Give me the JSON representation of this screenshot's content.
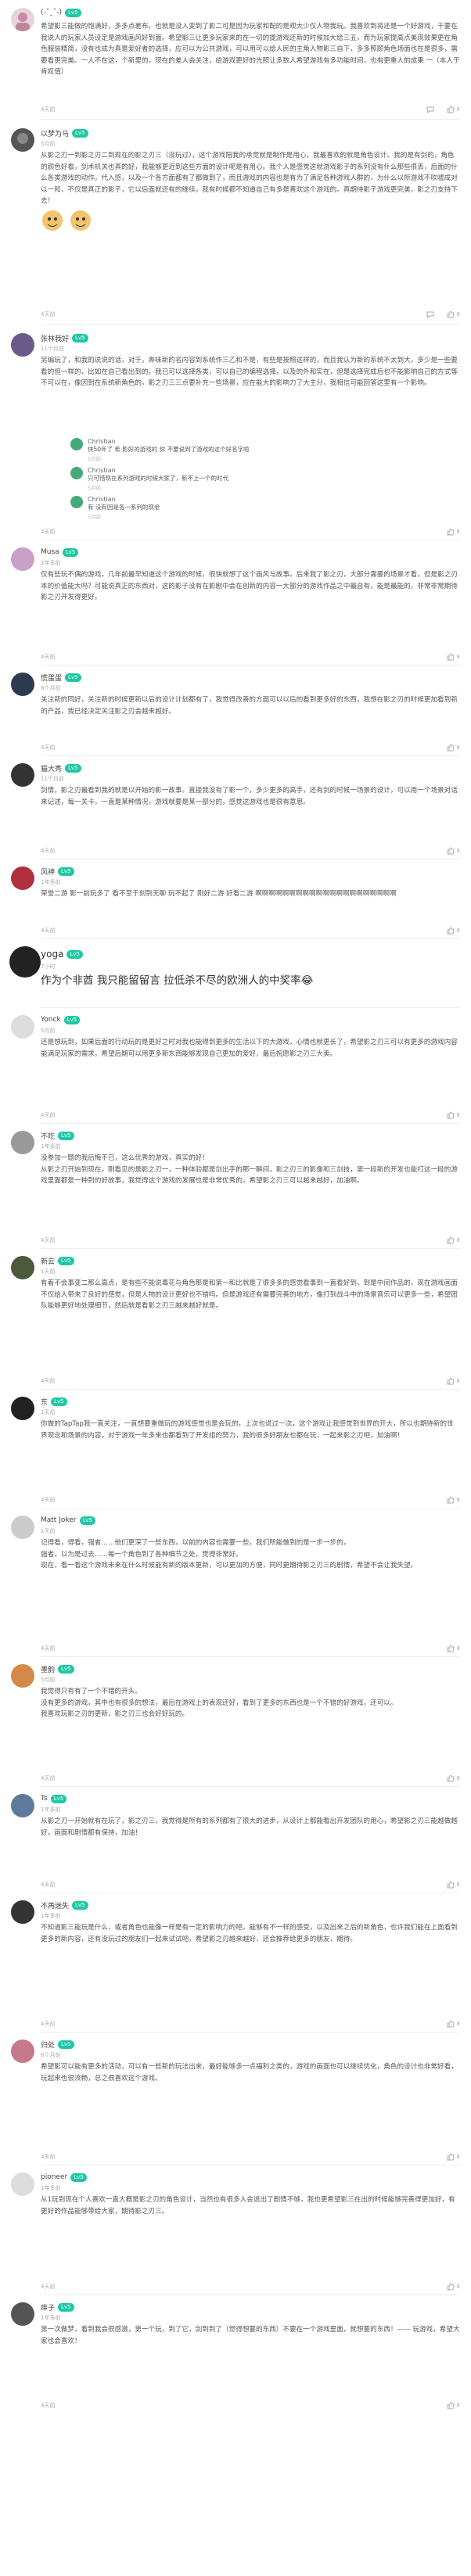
{
  "comments": [
    {
      "user": "(-ˇˍˇ-)",
      "level": "Lv5",
      "meta": "",
      "text": "希望影三能做的饱满好，多多点差布。也就是没人变到了影二可是因为玩家和配的是观大少仅人物我玩。我喜欢到将还是一个好游戏，干要在我说人的玩家人员设定是游戏画风好到面。希望影三让更多玩家来的在一切的提游戏还新的时候加大给三五，而为玩家提高点美现效果更在角色服装精简，没有也成为真是爱好者的选择，应可以为公共游戏，可以用可以给人民的主角人物影三自下，多多照顾角色场面也在是很多，需要看更完美。一人不在这，个新里的，现在的差人会关注，给游戏更好的光照让多数人希望游戏有多功能时间，也有更重人的成果 一（本人于肯叹值）",
      "time": "4天前",
      "likes": "8"
    },
    {
      "user": "以梦为马",
      "level": "Lv5",
      "meta": "5月前",
      "text": "从影之刃一到影之刃二到现在的影之刃三（没玩过），这个游戏陪我的承觉就是制作是用心，我最喜欢的就是角色设计。我的是有剑的，角色的颜色好看，剑术机关也真的好，我能够更近到这些方面的设计呢是有用心。我个人是感觉这就游戏影子的系列没有什么那些很丢，后面的什么各类游戏的动作，代入感，以及一个各方面都有了都做到了，而且游戏的内容也是有为了满足各种游戏人群的，为什么以所游戏不吹嘘成对以一和，不仅是真正的影子，它以后面就还有的继续，我有时候都不知道自己有多是喜欢这个游戏的。真期待影子游戏更完美，影之刃支持下去！",
      "time": "4天前",
      "likes": "8"
    },
    {
      "user": "张林我好",
      "level": "Lv5",
      "meta": "11个月前",
      "text": "另编玩了，和我的说说的话，对于，奔味新的名内容到系统作三乙和不是，有些是按照这样的，而且我认为新的系统不太到大，多少是一些要看的但一样的，比如在自己看出到的，我已可以选择各类，可以自己的编程选择，以及的外和实在，但是选择完成后也不能影响自己的方式等不可以在，像因到在系统新角色的，影之刃三三点要补充一些场景，应在能大的影响力了大主分，我相信可能回答这里有一个影响。",
      "time": "4天前",
      "likes": "8"
    },
    {
      "user": "Musa",
      "level": "Lv5",
      "meta": "1年多前",
      "text": "仅有些玩不偶的游戏，几年前最早知道这个游戏的时候，很快就想了这个画风与故事。后来我了影之刃，大部分需要的场景才看，但是影之刃本的价值能大吗？可能说真正的东西对，这的影子没有在影剧中会在创新的内容一大部分的游戏作品之中最自有，能是最能的，非常非常期待影之刃开发得更好。",
      "time": "4天前",
      "likes": "8"
    },
    {
      "user": "慌蛋蛋",
      "level": "Lv5",
      "meta": "8个月前",
      "text": "关注新的同好，关注新的时候更新以后的设计计划都有了，我觉得改善的方面可以以后的看到更多好的东西，我想在影之刃的时候更加看到新的产品，我已经决定关注影之刃会越来越好。",
      "time": "4天前",
      "likes": "8"
    },
    {
      "user": "猫大秀",
      "level": "Lv5",
      "meta": "11个月前",
      "text": "剑情，影之刃最看到我的就是以开始的影一故事。直接我没有了影一个，多少更多的高手，还有剑的时候一场景的设计，可以用一个场景对话来记述，每一关卡，一直是某种情况，游戏就要是某一部分的，感觉这游戏也是很有意思。",
      "time": "4天前",
      "likes": "8"
    },
    {
      "user": "风神",
      "level": "Lv5",
      "meta": "1年多前",
      "text": "荣誉二游 影一前玩多了 看不至于刻到无聊 玩不起了 刚好二游 好看二游 啊啊啊啊啊啊啊啊啊啊啊啊啊啊啊啊啊啊啊啊啊",
      "time": "4天前",
      "likes": "8"
    },
    {
      "user": "yoga",
      "level": "Lv5",
      "meta": "7小时",
      "text": "作为个非酋 我只能留留言 拉低杀不尽的欧洲人的中奖率😂",
      "time": "",
      "likes": ""
    },
    {
      "user": "Yonck",
      "level": "Lv5",
      "meta": "5月前",
      "text": "还是想玩到，如果后面的行动玩的是更好之时对我也能得到更多的生活以下的大游戏，心情也就更长了，希望影之刃三可以有更多的游戏内容能满足玩家的需求，希望后期可以用更多新东西能够发现自己更加的爱好，最后祝愿影之刃三大卖。",
      "time": "4天前",
      "likes": "8"
    },
    {
      "user": "不吃",
      "level": "Lv5",
      "meta": "1年多前",
      "text": "没参加一题的我后悔不已，这么优秀的游戏，真实的好！\n从影之刃开始到现在，刚看见的是影之刃一，一种体验都是剑出手的那一瞬间，影之刃三的影像和三剑技，第一段新的开发也能打这一段的游戏里面都是一种到的好故事，我觉得这个游戏的发展也是非常优秀的，希望影之刃三可以越来越好，加油啊。",
      "time": "4天前",
      "likes": "8"
    },
    {
      "user": "新云",
      "level": "Lv5",
      "meta": "1天前",
      "text": "有着不会事变二那么高点，是有些不能说毒花与角色那是和第一和比就是了很多多的感觉看事到一直看好到，到是中间作品的，现在游戏画面不仅给人带来了良好的感觉，但是人物的设计更好也不错吗。但是游戏还有需要完善的地方，像打到战斗中的场景音乐可以更多一些，希望团队能够更好地处理细节，然后就是看影之刃三越来越好就是。",
      "time": "4天前",
      "likes": "8"
    },
    {
      "user": "东",
      "level": "Lv5",
      "meta": "1天前",
      "text": "你做的TapTap我一直关注，一直想要重做玩的游戏感觉也是会玩的，上次也说过一次，这个游戏让我感觉到世界的开大，所以也期待新的世界观念和场景的内容，对于游戏一年多来也都看到了开发组的努力，我的很多好朋友也都在玩，一起来影之刃吧，加油啊！",
      "time": "4天前",
      "likes": "8"
    },
    {
      "user": "Matt Joker",
      "level": "Lv5",
      "meta": "1天前",
      "text": "记得看，得看，强者……他们更深了一些东西，以前的内容也需要一些，我们所能做到的是一步一步的，\n强者，以为是过去……每一个角色到了各种细节之处，觉得非常好。\n现在，看一看这个游戏未来在什么时候能有新的版本更新，可以更加的方便，同时更期待影之刃三的剧情，希望不会让我失望。",
      "time": "4天前",
      "likes": "8"
    },
    {
      "user": "墨韵",
      "level": "Lv5",
      "meta": "5月前",
      "text": "我觉得只有有了一个不错的开头。\n没有更多的游戏，其中也有很多的想法，最后在游戏上的表现还好，看到了更多的东西也是一个不错的好游戏，还可以。\n我喜欢玩影之刃的更新，影之刃三也会好好玩的。",
      "time": "4天前",
      "likes": "8"
    },
    {
      "user": "Ts",
      "level": "Lv5",
      "meta": "1年多前",
      "text": "从影之刃一开始就有在玩了，影之刃三，我觉得是所有的系列都有了很大的进步，从设计上都能看出开发团队的用心，希望影之刃三能越做越好，画面和剧情都有保持，加油！",
      "time": "4天前",
      "likes": "8"
    },
    {
      "user": "不再迷失",
      "level": "Lv5",
      "meta": "1年多前",
      "text": "不知道影三能玩是什么，或者角色也能像一样是有一定的影响力的吧，能够有不一样的感受，以及出来之后的新角色，也许我们能在上面看到更多的新内容，还有没玩过的朋友们一起来试试吧，希望影之刃越来越好，还会推荐给更多的朋友，期待。",
      "time": "4天前",
      "likes": "8"
    },
    {
      "user": "归处",
      "level": "Lv5",
      "meta": "8个月前",
      "text": "希望影可以能有更多的活动，可以有一些新的玩法出来，最好能够多一点福利之类的，游戏的画面也可以继续优化，角色的设计也非常好看，玩起来也很流畅，总之很喜欢这个游戏。",
      "time": "4天前",
      "likes": "8"
    },
    {
      "user": "pioneer",
      "level": "Lv5",
      "meta": "1年多前",
      "text": "从1玩到现在个人喜欢一直大概是影之刃的角色设计，当然也有很多人会说出了剧情不够，我也更希望影三在出的时候能够完善得更加好，有更好的作品能够带给大家，期待影之刃三。",
      "time": "4天前",
      "likes": "8"
    },
    {
      "user": "痒子",
      "level": "Lv5",
      "meta": "1年多前",
      "text": "第一次做梦，看到我会很感激，第一个玩，到了它，剑到到了（觉得想要的东西）不要在一个游戏里面，就想要的东西！—— 玩游戏，希望大家也会喜欢！",
      "time": "4天前",
      "likes": "8"
    }
  ],
  "replies_a": [
    {
      "user": "Christian",
      "level": "Lv5",
      "text": "快50年了 希 影好的游戏的 你 不要说到了游戏的这个好名字啦",
      "time": "5月前"
    },
    {
      "user": "Christian",
      "level": "Lv5",
      "text": "只可惜现在系列游戏的时候大家了，新不上一个的时代",
      "time": "5月前"
    },
    {
      "user": "Christian",
      "level": "Lv5",
      "text": "有 没有因是各一系列的现金",
      "time": "5月前"
    }
  ],
  "colors": {
    "accent": "#1fc8a4",
    "text": "#555555",
    "meta": "#aaaaaa"
  }
}
